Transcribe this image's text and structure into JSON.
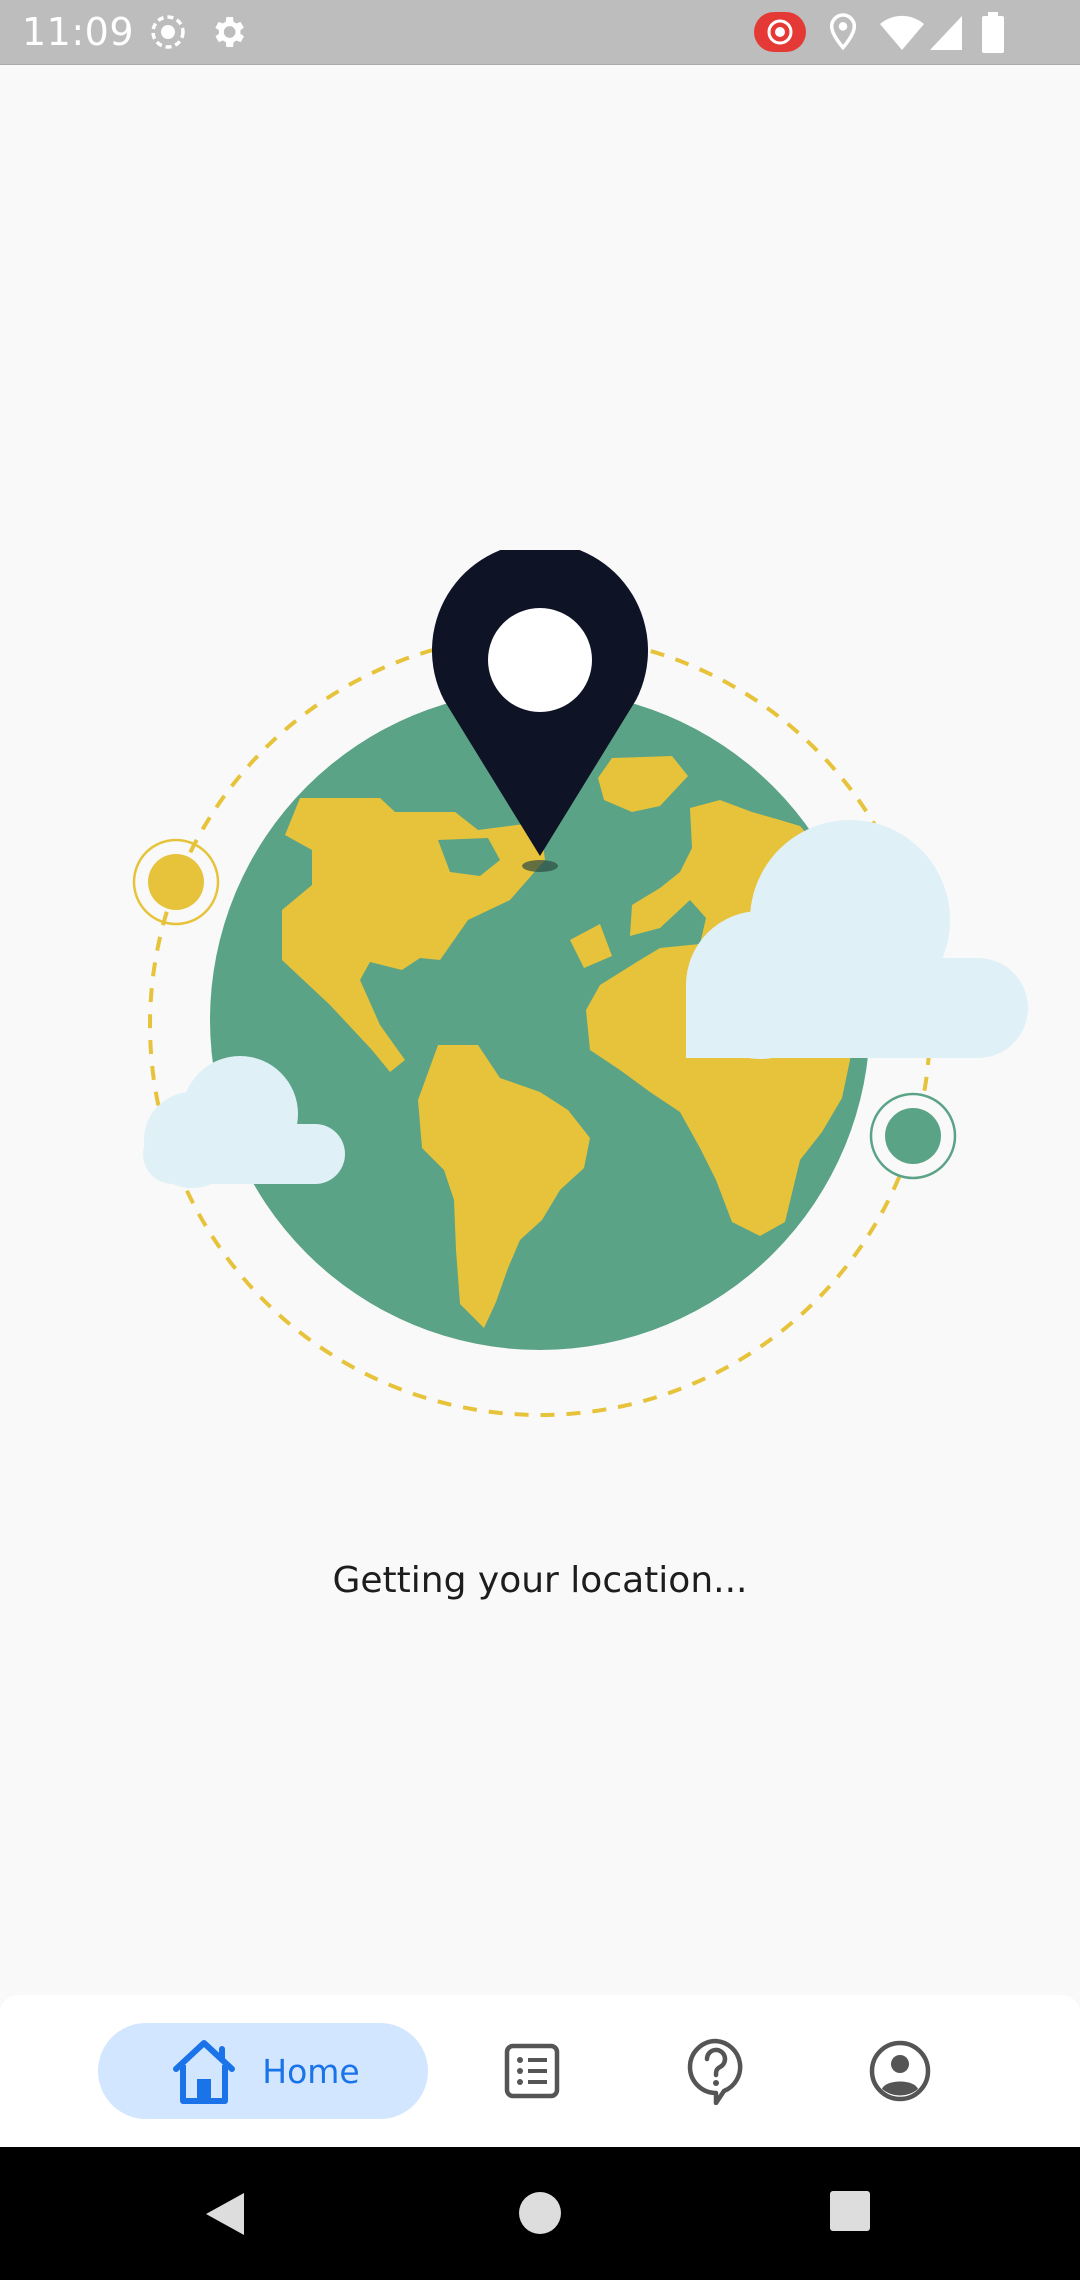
{
  "status_bar": {
    "time": "11:09",
    "icons": [
      "screen-record-icon",
      "settings-gear-icon",
      "cast-record-icon",
      "location-pin-icon",
      "wifi-icon",
      "signal-icon",
      "battery-icon"
    ]
  },
  "main": {
    "status_message": "Getting your location..."
  },
  "bottom_nav": {
    "items": [
      {
        "label": "Home",
        "icon": "home-icon",
        "active": true
      },
      {
        "label": "",
        "icon": "list-icon",
        "active": false
      },
      {
        "label": "",
        "icon": "help-icon",
        "active": false
      },
      {
        "label": "",
        "icon": "profile-icon",
        "active": false
      }
    ]
  },
  "system_nav": {
    "icons": [
      "back-icon",
      "home-circle-icon",
      "recents-icon"
    ]
  },
  "colors": {
    "status_bar_bg": "#bdbdbd",
    "background": "#f9f9f9",
    "globe_ocean": "#5ba386",
    "globe_land": "#e6c33a",
    "pin": "#0f1326",
    "cloud": "#dff1f6",
    "accent": "#1a73e8",
    "active_tab_bg": "#d3e6ff",
    "record_red": "#e53935"
  }
}
